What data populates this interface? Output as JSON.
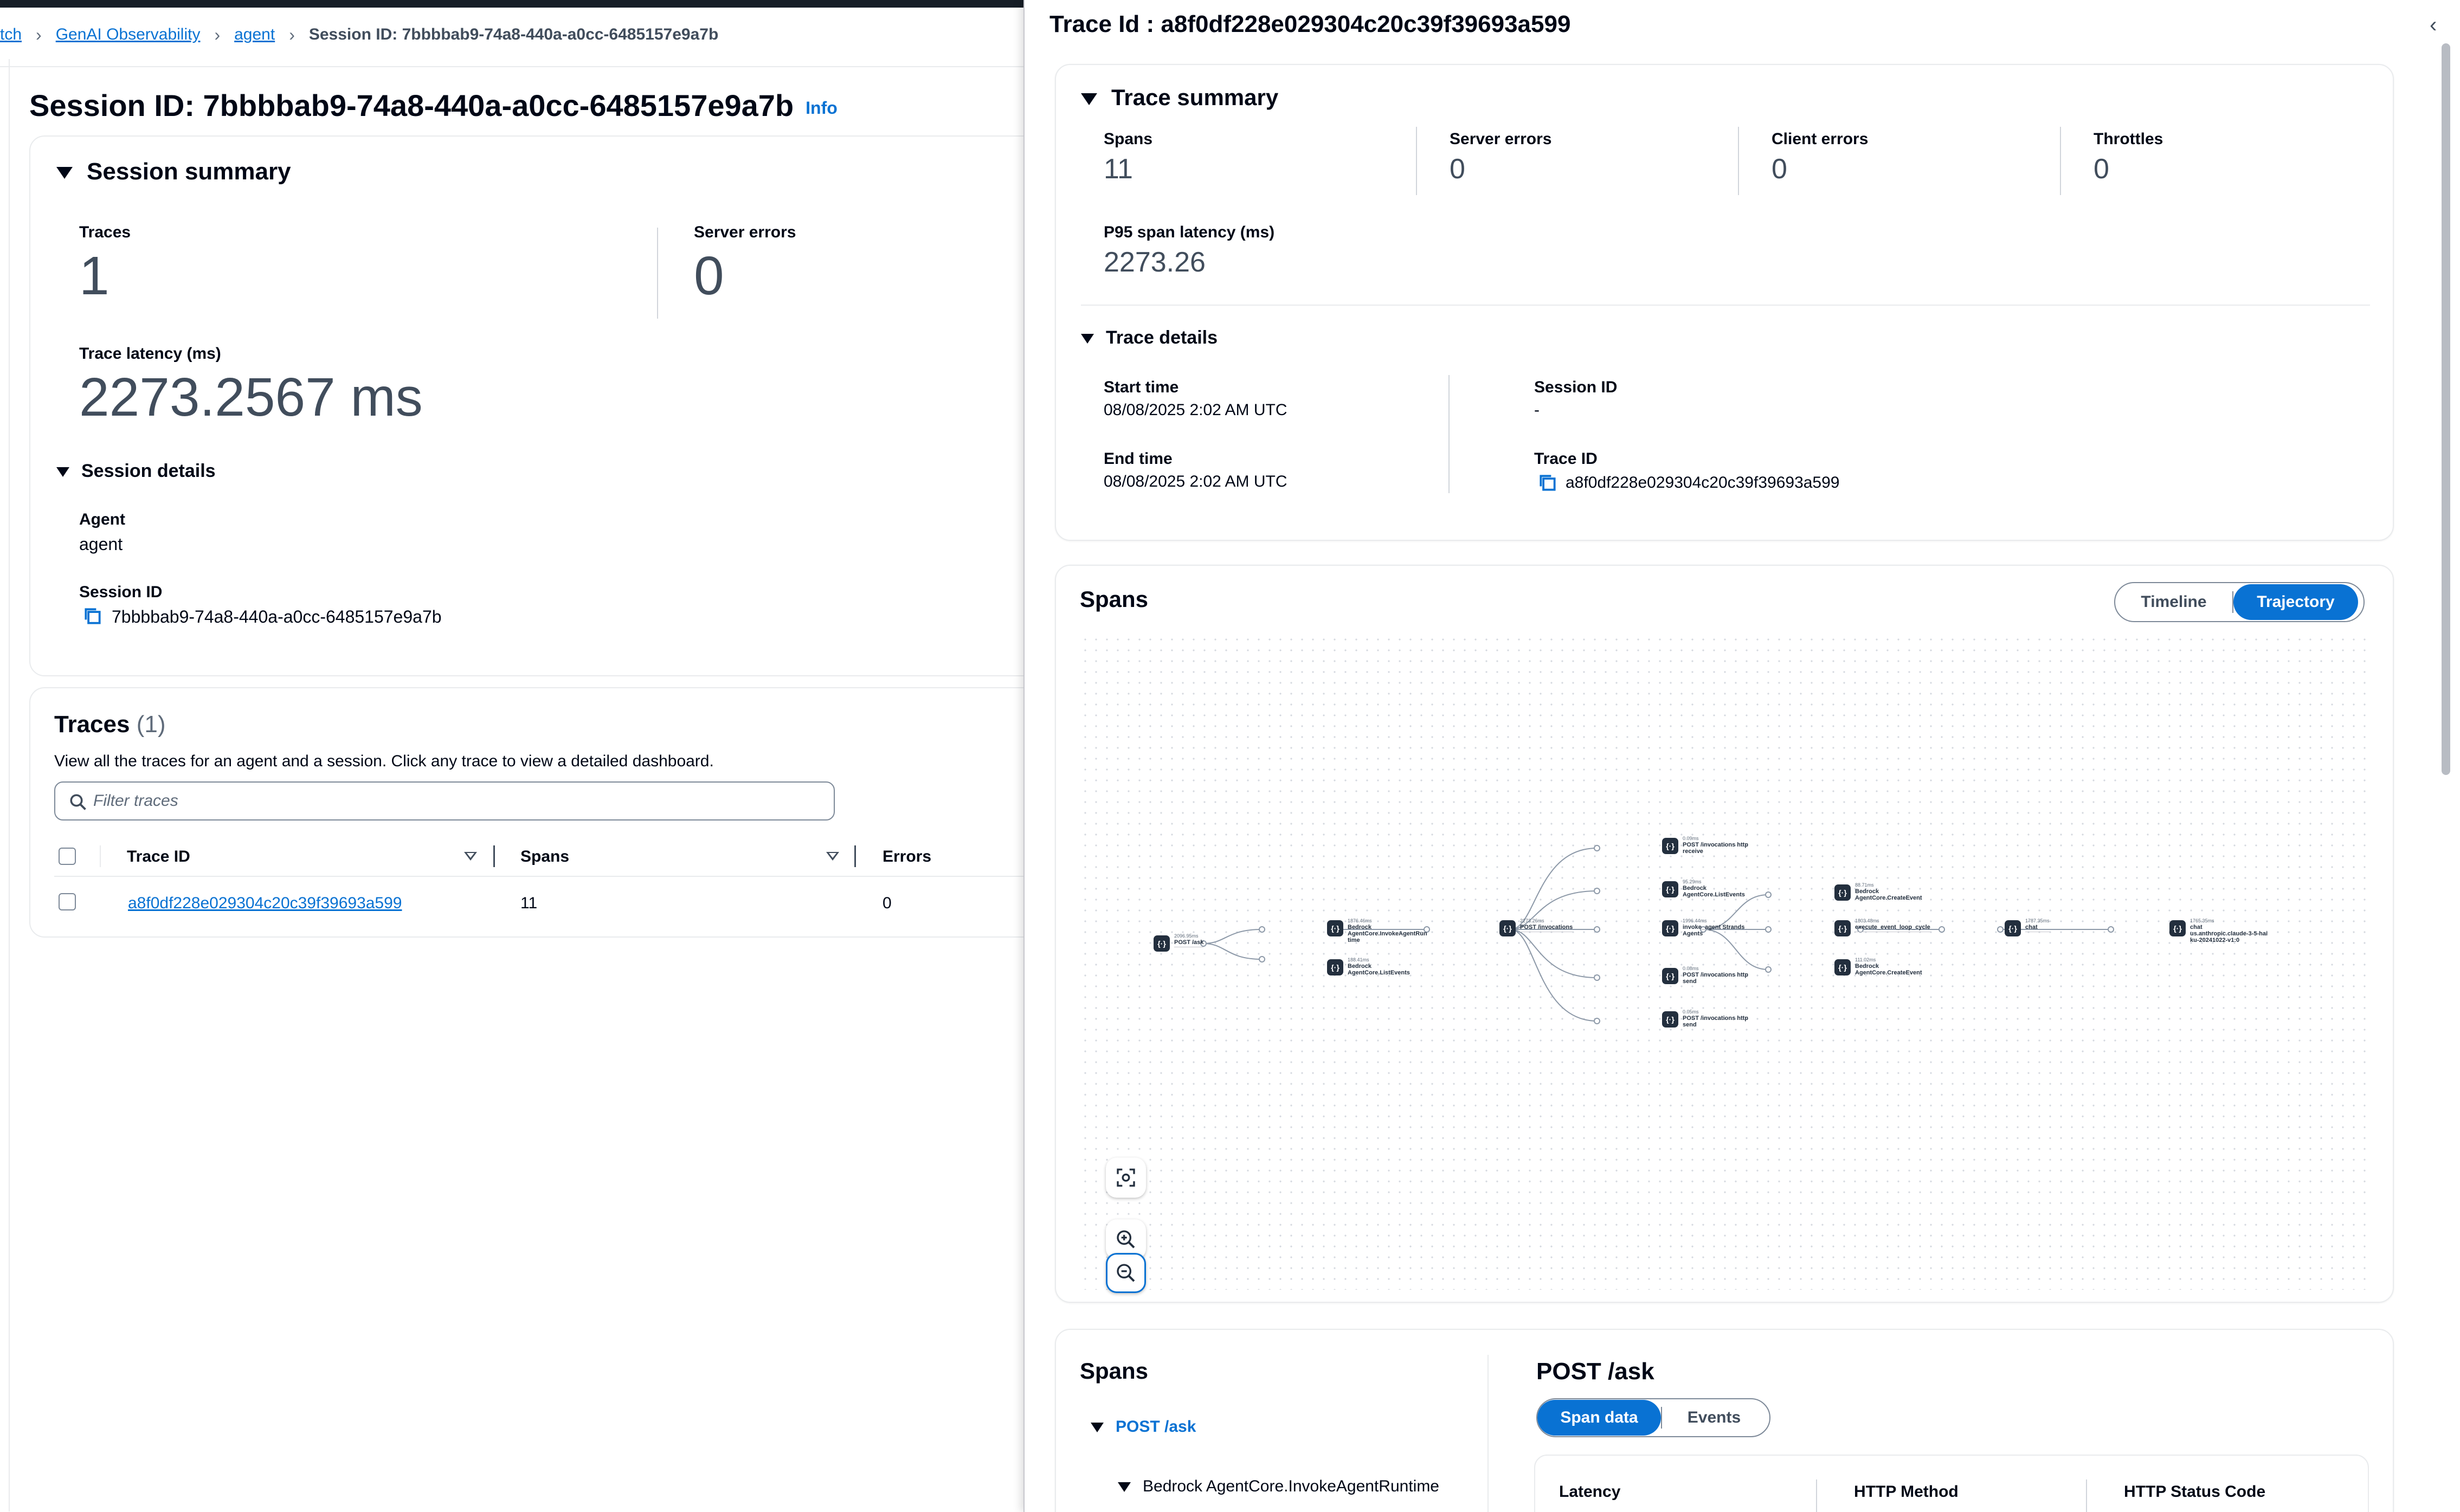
{
  "breadcrumb": {
    "items": [
      "tch",
      "GenAI Observability",
      "agent"
    ],
    "current": "Session ID: 7bbbbab9-74a8-440a-a0cc-6485157e9a7b"
  },
  "page": {
    "title": "Session ID: 7bbbbab9-74a8-440a-a0cc-6485157e9a7b",
    "info_label": "Info"
  },
  "session_summary": {
    "heading": "Session summary",
    "traces_label": "Traces",
    "traces_value": "1",
    "server_errors_label": "Server errors",
    "server_errors_value": "0",
    "latency_label": "Trace latency (ms)",
    "latency_value": "2273.2567 ms"
  },
  "session_details": {
    "heading": "Session details",
    "agent_label": "Agent",
    "agent_value": "agent",
    "session_id_label": "Session ID",
    "session_id_value": "7bbbbab9-74a8-440a-a0cc-6485157e9a7b"
  },
  "traces": {
    "title": "Traces",
    "count": "(1)",
    "description": "View all the traces for an agent and a session. Click any trace to view a detailed dashboard.",
    "filter_placeholder": "Filter traces",
    "columns": [
      "Trace ID",
      "Spans",
      "Errors"
    ],
    "rows": [
      {
        "trace_id": "a8f0df228e029304c20c39f39693a599",
        "spans": "11",
        "errors": "0"
      }
    ]
  },
  "panel": {
    "title": "Trace Id : a8f0df228e029304c20c39f39693a599",
    "close_icon": "chevron-left-icon"
  },
  "trace_summary": {
    "heading": "Trace summary",
    "stats": [
      {
        "label": "Spans",
        "value": "11"
      },
      {
        "label": "Server errors",
        "value": "0"
      },
      {
        "label": "Client errors",
        "value": "0"
      },
      {
        "label": "Throttles",
        "value": "0"
      }
    ],
    "p95_label": "P95 span latency (ms)",
    "p95_value": "2273.26"
  },
  "trace_details": {
    "heading": "Trace details",
    "start_label": "Start time",
    "start_value": "08/08/2025 2:02 AM UTC",
    "end_label": "End time",
    "end_value": "08/08/2025 2:02 AM UTC",
    "session_label": "Session ID",
    "session_value": "-",
    "trace_label": "Trace ID",
    "trace_value": "a8f0df228e029304c20c39f39693a599"
  },
  "spans_graph": {
    "title": "Spans",
    "view_options": [
      "Timeline",
      "Trajectory"
    ],
    "active_view": "Trajectory",
    "nodes": [
      {
        "sub": "2096.95ms",
        "label": "POST /ask"
      },
      {
        "sub": "1876.46ms",
        "label": "Bedrock\nAgentCore.InvokeAgentRun\ntime"
      },
      {
        "sub": "188.41ms",
        "label": "Bedrock\nAgentCore.ListEvents"
      },
      {
        "sub": "2273.26ms",
        "label": "POST /invocations"
      },
      {
        "sub": "0.09ms",
        "label": "POST /invocations http\nreceive"
      },
      {
        "sub": "95.29ms",
        "label": "Bedrock\nAgentCore.ListEvents"
      },
      {
        "sub": "1996.44ms",
        "label": "invoke_agent Strands\nAgents"
      },
      {
        "sub": "0.08ms",
        "label": "POST /invocations http\nsend"
      },
      {
        "sub": "0.05ms",
        "label": "POST /invocations http\nsend"
      },
      {
        "sub": "88.71ms",
        "label": "Bedrock\nAgentCore.CreateEvent"
      },
      {
        "sub": "1803.48ms",
        "label": "execute_event_loop_cycle"
      },
      {
        "sub": "111.02ms",
        "label": "Bedrock\nAgentCore.CreateEvent"
      },
      {
        "sub": "1787.35ms",
        "label": "chat"
      },
      {
        "sub": "1765.35ms",
        "label": "chat\nus.anthropic.claude-3-5-hai\nku-20241022-v1:0"
      }
    ]
  },
  "span_detail": {
    "list_title": "Spans",
    "tree": [
      "POST /ask",
      "Bedrock AgentCore.InvokeAgentRuntime"
    ],
    "selected_title": "POST /ask",
    "tabs": [
      "Span data",
      "Events"
    ],
    "active_tab": "Span data",
    "columns": [
      "Latency",
      "HTTP Method",
      "HTTP Status Code"
    ]
  },
  "colors": {
    "accent": "#0972d3",
    "text": "#000716",
    "node": "#232f3e"
  }
}
